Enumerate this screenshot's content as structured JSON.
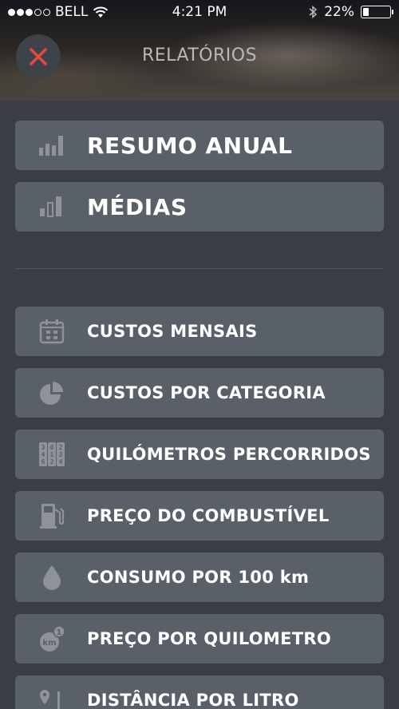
{
  "status_bar": {
    "carrier": "BELL",
    "time": "4:21 PM",
    "battery_text": "22%",
    "battery_level": 0.22
  },
  "header": {
    "title": "RELATÓRIOS",
    "close_icon": "close-icon",
    "accent_color": "#e8483f"
  },
  "main_reports": [
    {
      "label": "RESUMO ANUAL",
      "icon": "bar-chart-icon"
    },
    {
      "label": "MÉDIAS",
      "icon": "averages-chart-icon"
    }
  ],
  "reports": [
    {
      "label": "CUSTOS MENSAIS",
      "icon": "calendar-icon"
    },
    {
      "label": "CUSTOS POR CATEGORIA",
      "icon": "pie-chart-icon"
    },
    {
      "label": "QUILÓMETROS PERCORRIDOS",
      "icon": "odometer-icon"
    },
    {
      "label": "PREÇO DO COMBUSTÍVEL",
      "icon": "fuel-pump-icon"
    },
    {
      "label": "CONSUMO POR 100 km",
      "icon": "drop-icon"
    },
    {
      "label": "PREÇO POR QUILOMETRO",
      "icon": "price-per-km-icon"
    },
    {
      "label": "DISTÂNCIA POR LITRO",
      "icon": "distance-pin-icon"
    }
  ],
  "odometer_digits": [
    "3",
    "0",
    "2",
    "4",
    "1",
    "3",
    "6",
    "2",
    "4"
  ],
  "km_badge": {
    "unit": "km",
    "count": "1"
  }
}
